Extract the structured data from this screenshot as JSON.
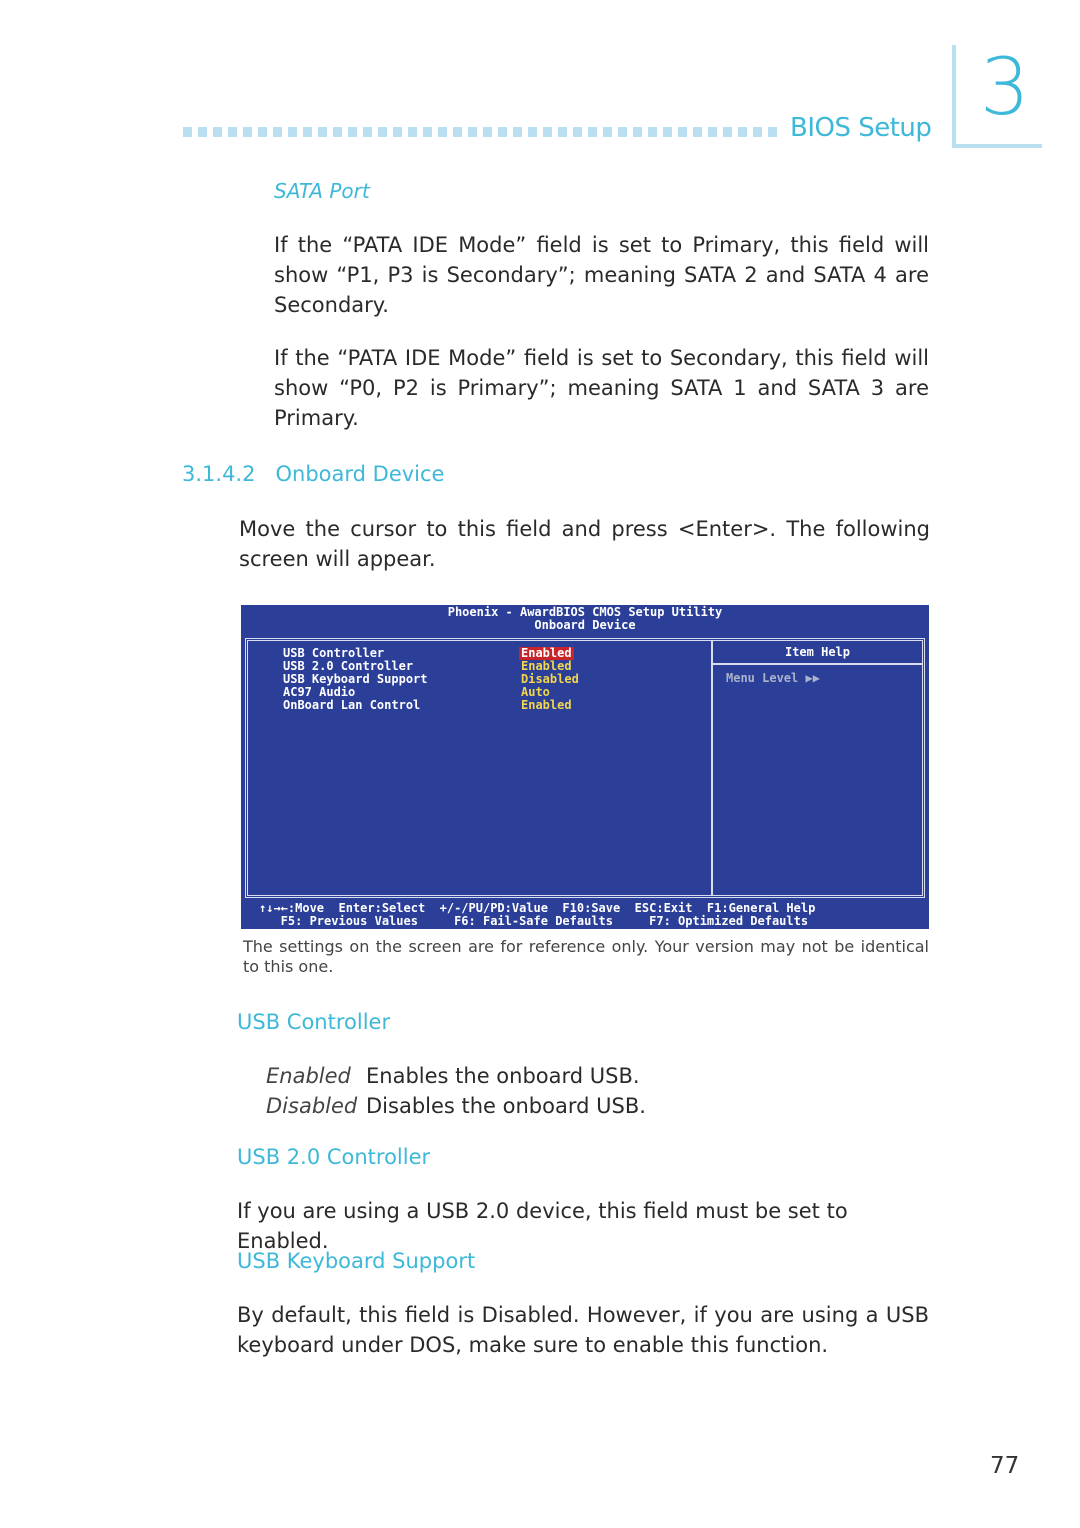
{
  "header": {
    "section_title": "BIOS Setup",
    "chapter_number": "3",
    "dot_count": 40
  },
  "sata_port": {
    "heading": "SATA  Port",
    "paragraphs": [
      "If the “PATA IDE Mode” field is set to Primary, this field will show “P1, P3 is Secondary”; meaning SATA 2 and SATA 4 are Secondary.",
      "If the “PATA IDE Mode” field is set to Secondary, this field will show “P0, P2 is Primary”; meaning SATA 1 and SATA 3 are Primary."
    ]
  },
  "onboard_device": {
    "heading": "3.1.4.2   Onboard Device",
    "paragraph": "Move the cursor to this field and press <Enter>. The following screen will appear."
  },
  "bios_screen": {
    "title_line1": "Phoenix - AwardBIOS CMOS Setup Utility",
    "title_line2": "Onboard Device",
    "items": [
      {
        "label": "USB Controller",
        "value": "Enabled",
        "selected": true
      },
      {
        "label": "USB 2.0 Controller",
        "value": "Enabled",
        "selected": false
      },
      {
        "label": "USB Keyboard Support",
        "value": "Disabled",
        "selected": false
      },
      {
        "label": "AC97 Audio",
        "value": "Auto",
        "selected": false
      },
      {
        "label": "OnBoard Lan Control",
        "value": "Enabled",
        "selected": false
      }
    ],
    "help_title": "Item Help",
    "menu_level": "Menu Level   ▶▶",
    "footer_line1": "↑↓→←:Move  Enter:Select  +/-/PU/PD:Value  F10:Save  ESC:Exit  F1:General Help",
    "footer_line2": "   F5: Previous Values     F6: Fail-Safe Defaults     F7: Optimized Defaults",
    "colors": {
      "background": "#2b3f99",
      "value": "#f2d54c",
      "selected_bg": "#c8252b"
    }
  },
  "caption": "The settings on the screen are for reference only. Your version may not be identical to this one.",
  "usb_controller": {
    "heading": "USB Controller",
    "options": [
      {
        "key": "Enabled",
        "desc": "Enables the onboard USB."
      },
      {
        "key": "Disabled",
        "desc": "Disables the onboard USB."
      }
    ]
  },
  "usb20_controller": {
    "heading": "USB 2.0 Controller",
    "paragraph": "If you are using a USB 2.0 device, this field must be set to Enabled."
  },
  "usb_keyboard": {
    "heading": "USB Keyboard Support",
    "paragraph": "By default, this field is Disabled. However, if you are using a USB keyboard under DOS, make sure to enable this function."
  },
  "page_number": "77"
}
